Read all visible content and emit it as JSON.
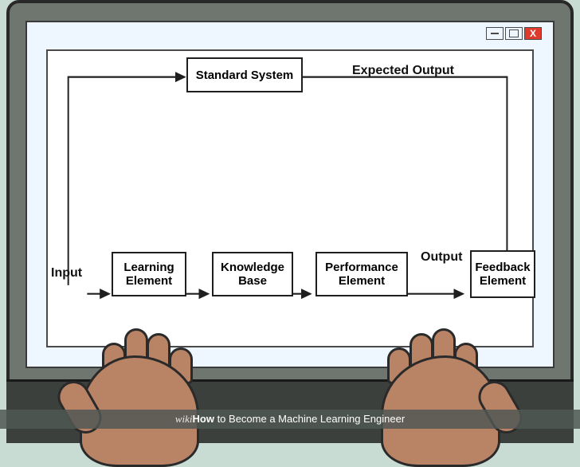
{
  "window": {
    "minimize_label": "minimize",
    "maximize_label": "maximize",
    "close_label": "close",
    "close_glyph": "X"
  },
  "diagram": {
    "input_label": "Input",
    "output_label": "Output",
    "expected_output_label": "Expected Output",
    "boxes": {
      "standard_system": "Standard System",
      "learning_element": "Learning\nElement",
      "knowledge_base": "Knowledge\nBase",
      "performance_element": "Performance\nElement",
      "feedback_element": "Feedback\nElement"
    },
    "flow": [
      {
        "from": "Input",
        "to": "Learning Element"
      },
      {
        "from": "Learning Element",
        "to": "Knowledge Base"
      },
      {
        "from": "Knowledge Base",
        "to": "Performance Element"
      },
      {
        "from": "Performance Element",
        "to": "Feedback Element",
        "label": "Output"
      },
      {
        "from": "Input",
        "to": "Standard System"
      },
      {
        "from": "Standard System",
        "to": "Feedback Element",
        "label": "Expected Output"
      }
    ]
  },
  "caption": {
    "brand_prefix": "wiki",
    "brand_suffix": "How",
    "title_rest": " to Become a Machine Learning Engineer"
  }
}
